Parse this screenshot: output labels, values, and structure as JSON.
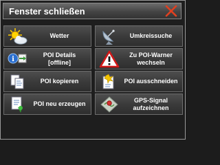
{
  "window": {
    "title": "Fenster schließen",
    "close_icon": "close-x-icon",
    "accent_color": "#e04020"
  },
  "buttons": [
    {
      "id": "weather",
      "label": "Wetter",
      "icon": "weather-sun-cloud-icon"
    },
    {
      "id": "radius-search",
      "label": "Umkreissuche",
      "icon": "satellite-dish-icon"
    },
    {
      "id": "poi-details",
      "label": "POI Details\n[offline]",
      "icon": "info-poi-icon"
    },
    {
      "id": "poi-warner",
      "label": "Zu POI-Warner\nwechseln",
      "icon": "warning-triangle-icon"
    },
    {
      "id": "poi-copy",
      "label": "POI kopieren",
      "icon": "copy-icon"
    },
    {
      "id": "poi-cut",
      "label": "POI ausschneiden",
      "icon": "cut-icon"
    },
    {
      "id": "poi-new",
      "label": "POI neu erzeugen",
      "icon": "new-poi-icon"
    },
    {
      "id": "gps-record",
      "label": "GPS-Signal\naufzeichnen",
      "icon": "gps-record-icon"
    }
  ]
}
